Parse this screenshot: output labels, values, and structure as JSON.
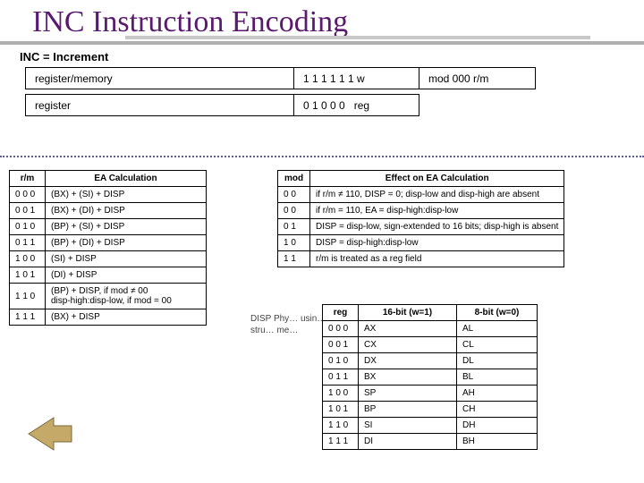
{
  "title": "INC Instruction Encoding",
  "inc_header": "INC = Increment",
  "encoding": {
    "rm_label": "register/memory",
    "rm_byte1": "1 1 1 1 1 1 w",
    "rm_byte2": "mod 000 r/m",
    "reg_label": "register",
    "reg_byte1": "0 1 0 0 0   reg"
  },
  "rm_table": {
    "h0": "r/m",
    "h1": "EA Calculation",
    "rows": [
      {
        "rm": "0 0 0",
        "ea": "(BX) + (SI) + DISP"
      },
      {
        "rm": "0 0 1",
        "ea": "(BX) + (DI) + DISP"
      },
      {
        "rm": "0 1 0",
        "ea": "(BP) + (SI) + DISP"
      },
      {
        "rm": "0 1 1",
        "ea": "(BP) + (DI) + DISP"
      },
      {
        "rm": "1 0 0",
        "ea": "(SI) + DISP"
      },
      {
        "rm": "1 0 1",
        "ea": "(DI) + DISP"
      },
      {
        "rm": "1 1 0",
        "ea": "(BP) + DISP, if mod ≠ 00\ndisp-high:disp-low, if mod = 00"
      },
      {
        "rm": "1 1 1",
        "ea": "(BX) + DISP"
      }
    ]
  },
  "mod_table": {
    "h0": "mod",
    "h1": "Effect on EA Calculation",
    "rows": [
      {
        "mod": "0 0",
        "eff": "if r/m ≠ 110, DISP = 0; disp-low and disp-high are absent"
      },
      {
        "mod": "0 0",
        "eff": "if r/m = 110, EA = disp-high:disp-low"
      },
      {
        "mod": "0 1",
        "eff": "DISP = disp-low, sign-extended to 16 bits; disp-high is absent"
      },
      {
        "mod": "1 0",
        "eff": "DISP = disp-high:disp-low"
      },
      {
        "mod": "1 1",
        "eff": "r/m is treated as a reg field"
      }
    ]
  },
  "reg_table": {
    "h0": "reg",
    "h1": "16-bit (w=1)",
    "h2": "8-bit (w=0)",
    "rows": [
      {
        "reg": "0 0 0",
        "w1": "AX",
        "w0": "AL"
      },
      {
        "reg": "0 0 1",
        "w1": "CX",
        "w0": "CL"
      },
      {
        "reg": "0 1 0",
        "w1": "DX",
        "w0": "DL"
      },
      {
        "reg": "0 1 1",
        "w1": "BX",
        "w0": "BL"
      },
      {
        "reg": "1 0 0",
        "w1": "SP",
        "w0": "AH"
      },
      {
        "reg": "1 0 1",
        "w1": "BP",
        "w0": "CH"
      },
      {
        "reg": "1 1 0",
        "w1": "SI",
        "w0": "DH"
      },
      {
        "reg": "1 1 1",
        "w1": "DI",
        "w0": "BH"
      }
    ]
  },
  "behind": "DISP\nPhy…\nusin…\nstru…\nme…"
}
